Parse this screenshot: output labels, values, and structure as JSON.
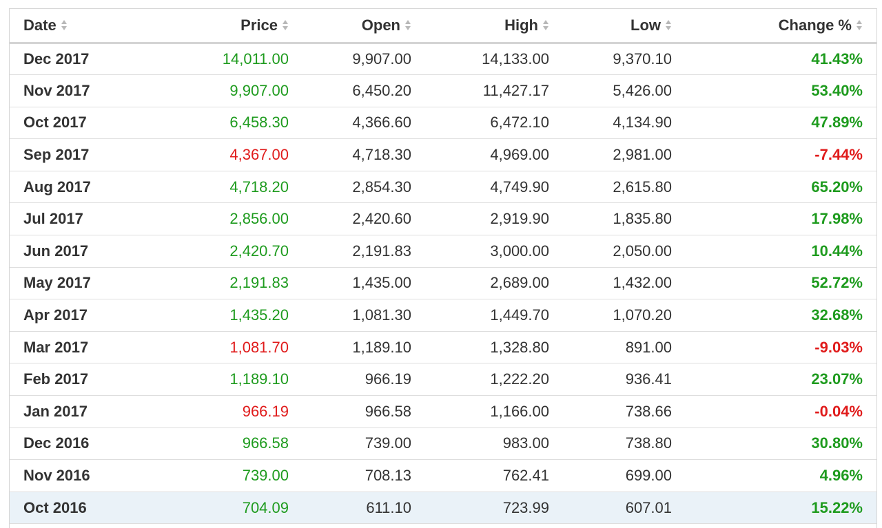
{
  "colors": {
    "positive": "#1e9b1e",
    "negative": "#e01b1b",
    "highlight_row": "#eaf2f8"
  },
  "columns": [
    {
      "key": "date",
      "label": "Date",
      "align": "left"
    },
    {
      "key": "price",
      "label": "Price",
      "align": "right"
    },
    {
      "key": "open",
      "label": "Open",
      "align": "right"
    },
    {
      "key": "high",
      "label": "High",
      "align": "right"
    },
    {
      "key": "low",
      "label": "Low",
      "align": "right"
    },
    {
      "key": "change",
      "label": "Change %",
      "align": "right"
    }
  ],
  "rows": [
    {
      "date": "Dec 2017",
      "price": "14,011.00",
      "open": "9,907.00",
      "high": "14,133.00",
      "low": "9,370.10",
      "change": "41.43%",
      "direction": "up"
    },
    {
      "date": "Nov 2017",
      "price": "9,907.00",
      "open": "6,450.20",
      "high": "11,427.17",
      "low": "5,426.00",
      "change": "53.40%",
      "direction": "up"
    },
    {
      "date": "Oct 2017",
      "price": "6,458.30",
      "open": "4,366.60",
      "high": "6,472.10",
      "low": "4,134.90",
      "change": "47.89%",
      "direction": "up"
    },
    {
      "date": "Sep 2017",
      "price": "4,367.00",
      "open": "4,718.30",
      "high": "4,969.00",
      "low": "2,981.00",
      "change": "-7.44%",
      "direction": "down"
    },
    {
      "date": "Aug 2017",
      "price": "4,718.20",
      "open": "2,854.30",
      "high": "4,749.90",
      "low": "2,615.80",
      "change": "65.20%",
      "direction": "up"
    },
    {
      "date": "Jul 2017",
      "price": "2,856.00",
      "open": "2,420.60",
      "high": "2,919.90",
      "low": "1,835.80",
      "change": "17.98%",
      "direction": "up"
    },
    {
      "date": "Jun 2017",
      "price": "2,420.70",
      "open": "2,191.83",
      "high": "3,000.00",
      "low": "2,050.00",
      "change": "10.44%",
      "direction": "up"
    },
    {
      "date": "May 2017",
      "price": "2,191.83",
      "open": "1,435.00",
      "high": "2,689.00",
      "low": "1,432.00",
      "change": "52.72%",
      "direction": "up"
    },
    {
      "date": "Apr 2017",
      "price": "1,435.20",
      "open": "1,081.30",
      "high": "1,449.70",
      "low": "1,070.20",
      "change": "32.68%",
      "direction": "up"
    },
    {
      "date": "Mar 2017",
      "price": "1,081.70",
      "open": "1,189.10",
      "high": "1,328.80",
      "low": "891.00",
      "change": "-9.03%",
      "direction": "down"
    },
    {
      "date": "Feb 2017",
      "price": "1,189.10",
      "open": "966.19",
      "high": "1,222.20",
      "low": "936.41",
      "change": "23.07%",
      "direction": "up"
    },
    {
      "date": "Jan 2017",
      "price": "966.19",
      "open": "966.58",
      "high": "1,166.00",
      "low": "738.66",
      "change": "-0.04%",
      "direction": "down"
    },
    {
      "date": "Dec 2016",
      "price": "966.58",
      "open": "739.00",
      "high": "983.00",
      "low": "738.80",
      "change": "30.80%",
      "direction": "up"
    },
    {
      "date": "Nov 2016",
      "price": "739.00",
      "open": "708.13",
      "high": "762.41",
      "low": "699.00",
      "change": "4.96%",
      "direction": "up"
    },
    {
      "date": "Oct 2016",
      "price": "704.09",
      "open": "611.10",
      "high": "723.99",
      "low": "607.01",
      "change": "15.22%",
      "direction": "up",
      "highlighted": true
    }
  ]
}
